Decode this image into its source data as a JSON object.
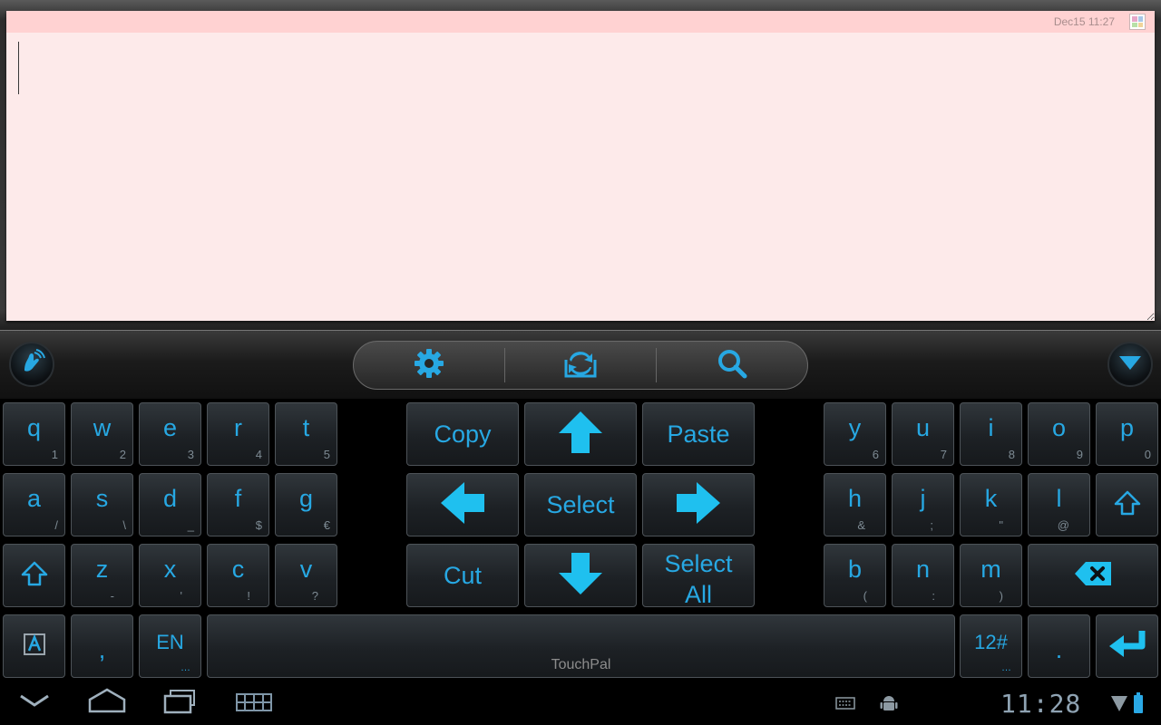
{
  "note": {
    "date": "Dec15 11:27",
    "text_value": ""
  },
  "toolbar": {
    "icons": [
      "touchpal-logo-icon",
      "gear-icon",
      "switch-icon",
      "search-icon",
      "collapse-down-icon"
    ]
  },
  "keys": {
    "row1": [
      {
        "main": "q",
        "sub": "1"
      },
      {
        "main": "w",
        "sub": "2"
      },
      {
        "main": "e",
        "sub": "3"
      },
      {
        "main": "r",
        "sub": "4"
      },
      {
        "main": "t",
        "sub": "5"
      },
      {
        "main": "y",
        "sub": "6"
      },
      {
        "main": "u",
        "sub": "7"
      },
      {
        "main": "i",
        "sub": "8"
      },
      {
        "main": "o",
        "sub": "9"
      },
      {
        "main": "p",
        "sub": "0"
      }
    ],
    "row2": [
      {
        "main": "a",
        "sub": "/"
      },
      {
        "main": "s",
        "sub": "\\"
      },
      {
        "main": "d",
        "sub": "_"
      },
      {
        "main": "f",
        "sub": "$"
      },
      {
        "main": "g",
        "sub": "€"
      },
      {
        "main": "h",
        "sub": "&"
      },
      {
        "main": "j",
        "sub": ";"
      },
      {
        "main": "k",
        "sub": "\""
      },
      {
        "main": "l",
        "sub": "@"
      }
    ],
    "row3": [
      {
        "main": "z",
        "sub": "-"
      },
      {
        "main": "x",
        "sub": "'"
      },
      {
        "main": "c",
        "sub": "!"
      },
      {
        "main": "v",
        "sub": "?"
      },
      {
        "main": "b",
        "sub": "("
      },
      {
        "main": "n",
        "sub": ":"
      },
      {
        "main": "m",
        "sub": ")"
      }
    ],
    "edit": {
      "copy": "Copy",
      "paste": "Paste",
      "select": "Select",
      "cut": "Cut",
      "select_all_1": "Select",
      "select_all_2": "All"
    },
    "bottom": {
      "comma": ",",
      "lang": "EN",
      "lang_dots": "…",
      "space": "TouchPal",
      "num": "12#",
      "num_dots": "…",
      "period": "."
    }
  },
  "system": {
    "clock": "11:28"
  },
  "colors": {
    "accent": "#27a8e3",
    "note_paper": "#fdeaea",
    "note_header": "#ffd2d2"
  }
}
